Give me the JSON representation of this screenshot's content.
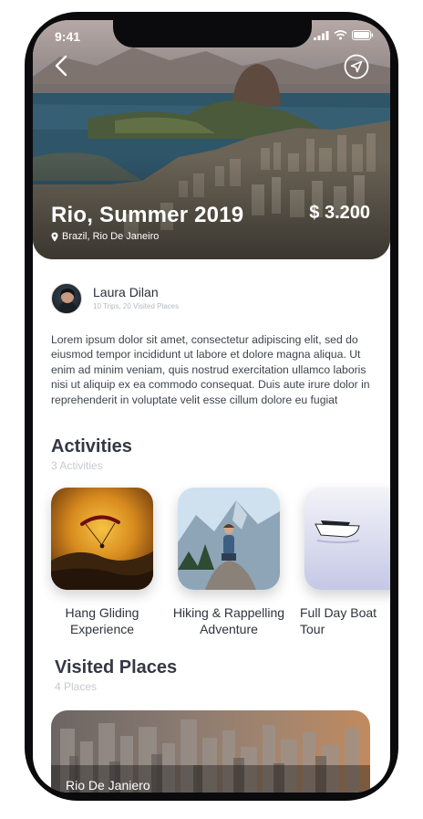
{
  "status_bar": {
    "time": "9:41"
  },
  "hero": {
    "title": "Rio, Summer 2019",
    "price": "$ 3.200",
    "location": "Brazil, Rio De Janeiro"
  },
  "author": {
    "name": "Laura Dilan",
    "meta": "10 Trips, 20 Visited Places"
  },
  "description": "Lorem ipsum dolor sit amet, consectetur adipiscing elit, sed do eiusmod tempor incididunt ut labore et dolore magna aliqua. Ut enim ad minim veniam, quis nostrud exercitation ullamco laboris nisi ut aliquip ex ea commodo consequat. Duis aute irure dolor in reprehenderit in voluptate velit esse cillum dolore eu fugiat",
  "activities": {
    "title": "Activities",
    "subtitle": "3 Activities",
    "items": [
      {
        "label": "Hang Gliding Experience"
      },
      {
        "label": "Hiking & Rappelling Adventure"
      },
      {
        "label": "Full Day Boat Tour"
      }
    ]
  },
  "visited_places": {
    "title": "Visited Places",
    "subtitle": "4 Places",
    "items": [
      {
        "label": "Rio De Janiero"
      }
    ]
  },
  "icons": {
    "back": "chevron-left-icon",
    "navigate": "navigation-arrow-icon",
    "location": "map-pin-icon"
  }
}
